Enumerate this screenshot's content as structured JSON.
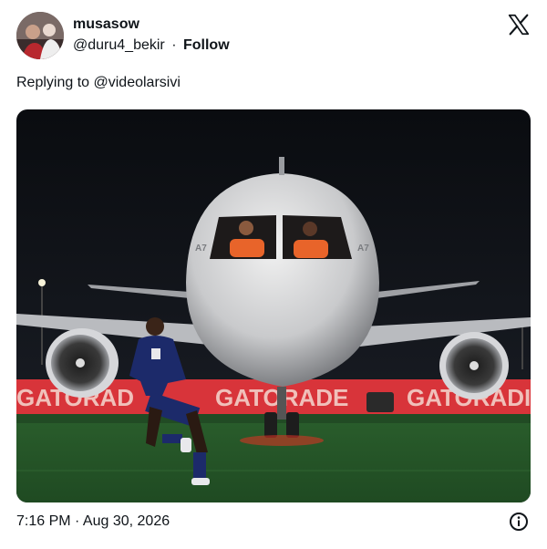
{
  "tweet": {
    "display_name": "musasow",
    "handle": "@duru4_bekir",
    "separator": "·",
    "follow_label": "Follow",
    "reply_prefix": "Replying to",
    "reply_handle": "@videolarsivi",
    "timestamp": "7:16 PM · Aug 30, 2026"
  },
  "media": {
    "billboard_texts": [
      "GATORAD",
      "GATORADE",
      "GATORADI"
    ],
    "aircraft_reg_left": "A7",
    "aircraft_reg_right": "A7"
  },
  "icons": {
    "brand": "x-logo-icon",
    "info": "info-icon"
  },
  "colors": {
    "billboard": "#d8343a",
    "pitch": "#2f6f2f",
    "sky": "#0c0e12",
    "kit_orange": "#e8642a"
  }
}
